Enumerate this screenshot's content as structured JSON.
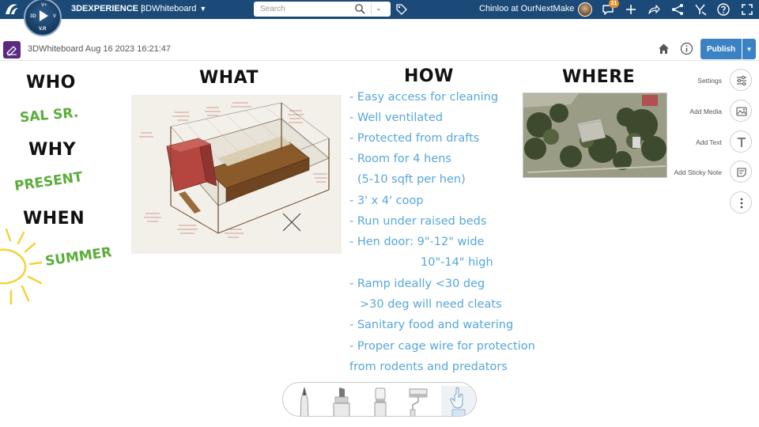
{
  "topbar": {
    "brand_bold": "3DEXPERIENCE",
    "brand_sep": " | ",
    "app_name": "3DWhiteboard",
    "compass": {
      "label_3d": "3D",
      "label_v": "V",
      "label_vr": "V.R",
      "label_top": "V+"
    },
    "search_placeholder": "Search",
    "user_label": "Chinloo at OurNextMake",
    "notifications_count": "21"
  },
  "subbar": {
    "doc_title": "3DWhiteboard Aug 16 2023 16:21:47",
    "publish_label": "Publish"
  },
  "canvas": {
    "who": "WHO",
    "who_value": "SAL SR.",
    "why": "WHY",
    "why_value": "PRESENT",
    "when": "WHEN",
    "when_value": "SUMMER",
    "what": "WHAT",
    "how": "HOW",
    "where": "WHERE",
    "how_lines": [
      "- Easy access for cleaning",
      "- Well ventilated",
      "- Protected from drafts",
      "- Room for 4 hens",
      "(5-10 sqft per hen)",
      "- 3' x 4' coop",
      "- Run under raised beds",
      "- Hen door: 9\"-12\" wide",
      "10\"-14\" high",
      "- Ramp ideally <30 deg",
      ">30 deg will need cleats",
      "- Sanitary food and watering",
      "- Proper cage wire for protection",
      "from rodents and predators"
    ]
  },
  "tools": {
    "settings": "Settings",
    "add_media": "Add Media",
    "add_text": "Add Text",
    "add_sticky": "Add Sticky Note"
  },
  "colors": {
    "topbar": "#1b4a78",
    "accent": "#3a82c4",
    "how_text": "#56a7d9",
    "green_text": "#5aae3a",
    "sun": "#f4d23a"
  }
}
